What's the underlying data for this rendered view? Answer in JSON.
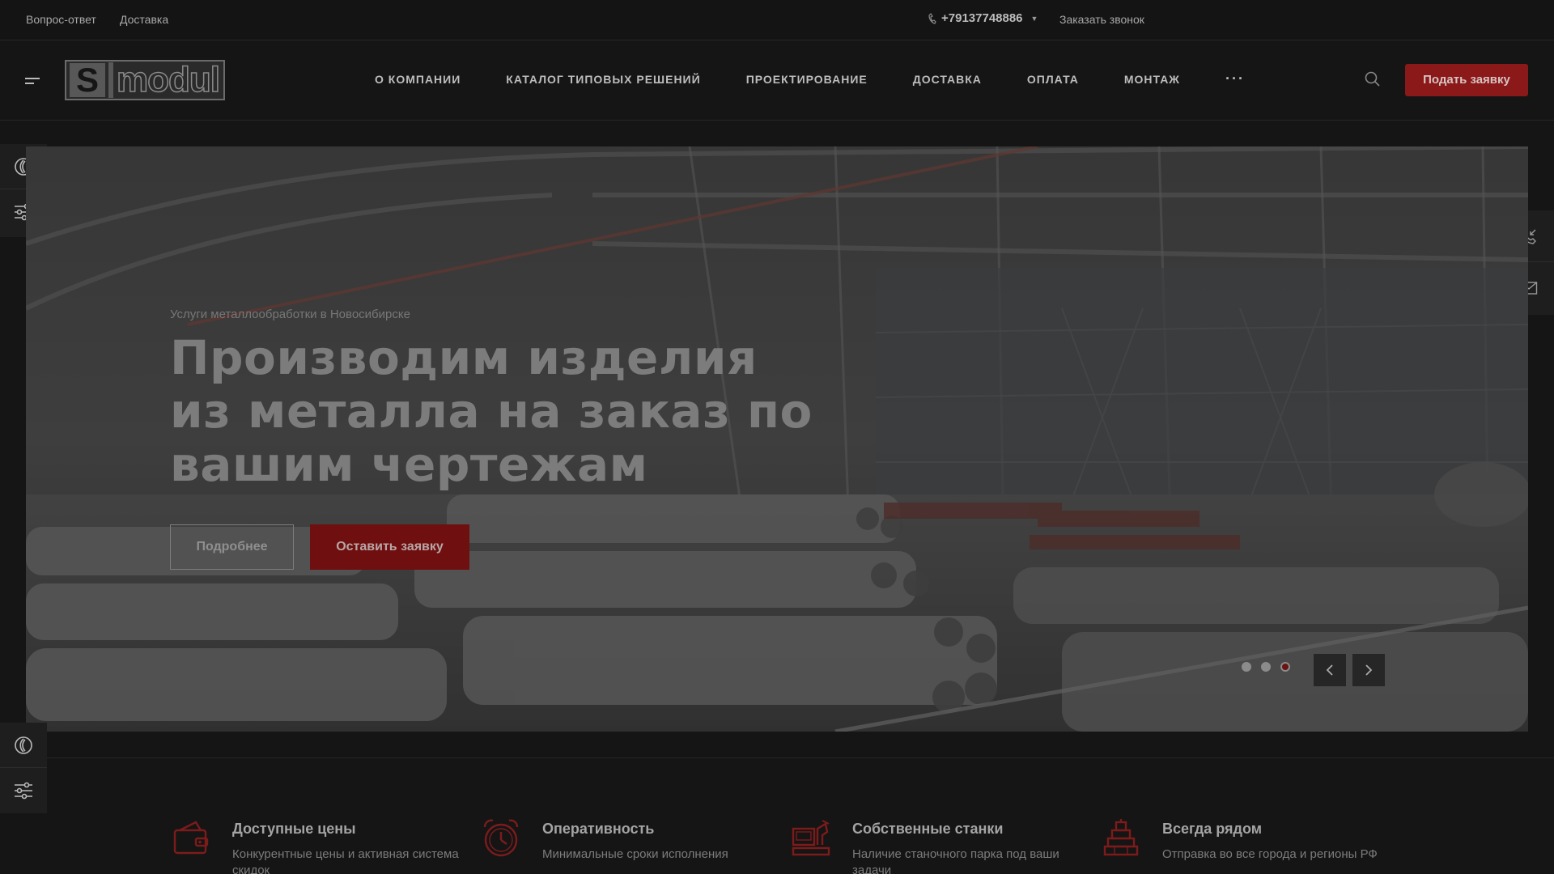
{
  "topbar": {
    "links": [
      "Вопрос-ответ",
      "Доставка"
    ],
    "phone": "+79137748886",
    "callback": "Заказать звонок"
  },
  "header": {
    "logo_letter": "S",
    "logo_word": "modul",
    "nav": [
      "О КОМПАНИИ",
      "КАТАЛОГ ТИПОВЫХ РЕШЕНИЙ",
      "ПРОЕКТИРОВАНИЕ",
      "ДОСТАВКА",
      "ОПЛАТА",
      "МОНТАЖ"
    ],
    "more": "···",
    "apply": "Подать заявку"
  },
  "hero": {
    "subtitle": "Услуги металлообработки в Новосибирске",
    "title": "Производим изделия из металла на заказ по вашим чертежам",
    "more_button": "Подробнее",
    "order_button": "Оставить заявку",
    "slides_count": 3,
    "active_slide": 3
  },
  "features": [
    {
      "icon": "wallet-icon",
      "title": "Доступные цены",
      "desc": "Конкурентные цены и активная система скидок"
    },
    {
      "icon": "alarm-clock-icon",
      "title": "Оперативность",
      "desc": "Минимальные сроки исполнения"
    },
    {
      "icon": "machine-tool-icon",
      "title": "Собственные станки",
      "desc": "Наличие станочного парка под ваши задачи"
    },
    {
      "icon": "cargo-boxes-icon",
      "title": "Всегда рядом",
      "desc": "Отправка во все города и регионы РФ"
    }
  ],
  "colors": {
    "accent": "#8c1919",
    "background": "#151515"
  }
}
